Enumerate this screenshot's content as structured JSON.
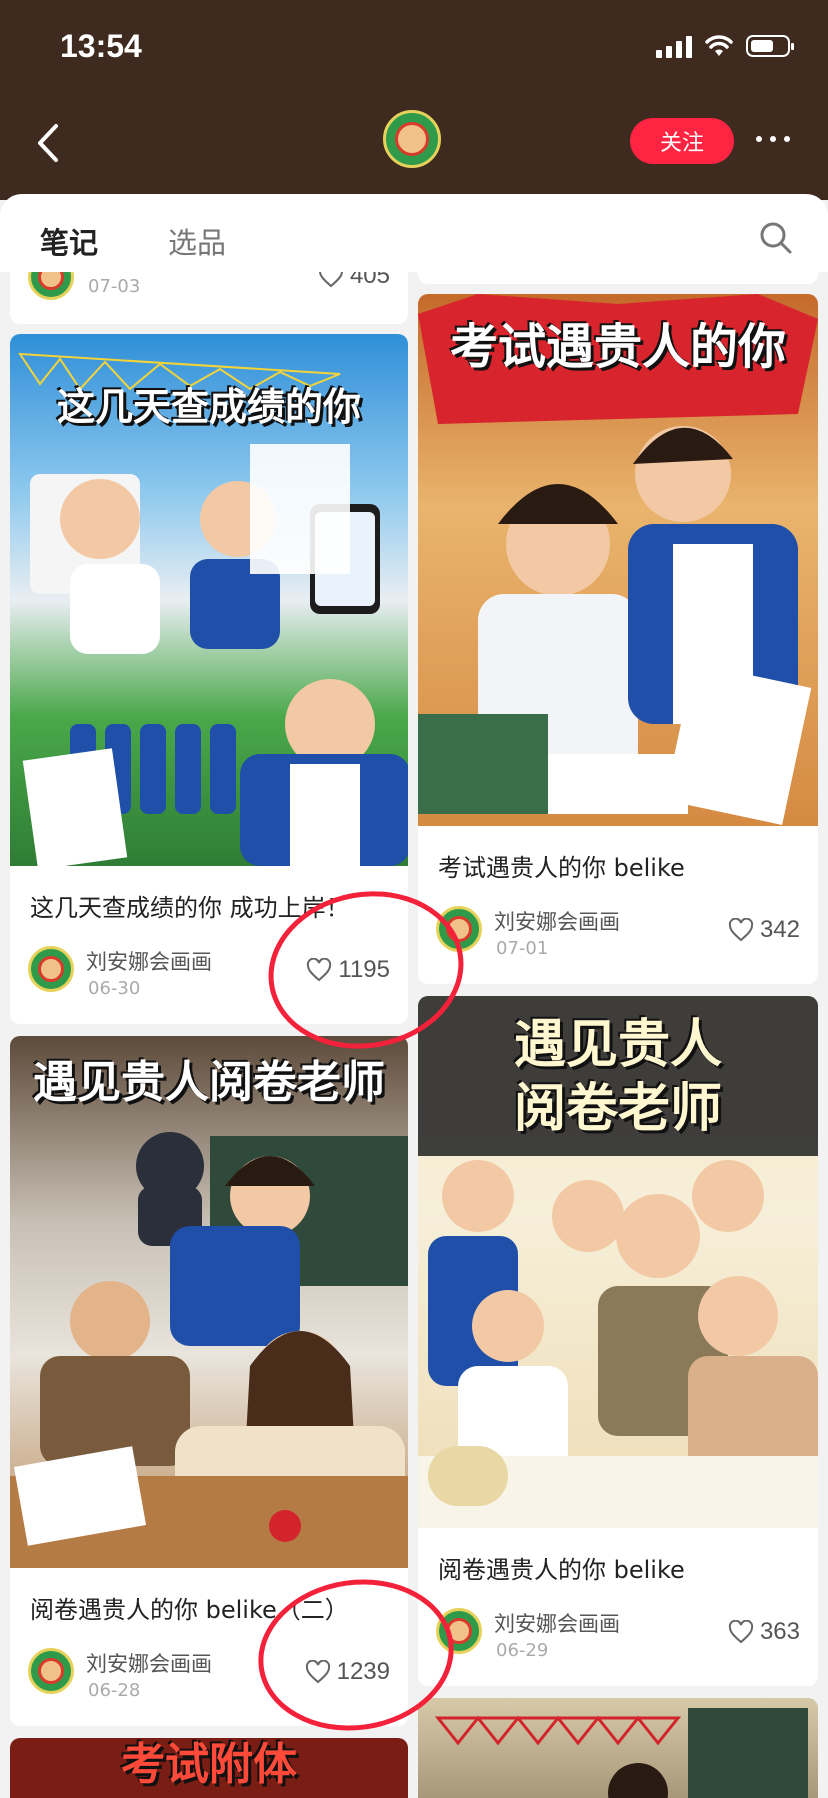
{
  "status": {
    "time": "13:54"
  },
  "header": {
    "follow_label": "关注"
  },
  "tabs": {
    "notes": "笔记",
    "products": "选品"
  },
  "top_card": {
    "date": "07-03",
    "likes": "405"
  },
  "cards": [
    {
      "image_text": "这几天查成绩的你",
      "title": "这几天查成绩的你 成功上岸！",
      "author": "刘安娜会画画",
      "date": "06-30",
      "likes": "1195"
    },
    {
      "image_text": "考试遇贵人的你",
      "title": "考试遇贵人的你 belike",
      "author": "刘安娜会画画",
      "date": "07-01",
      "likes": "342"
    },
    {
      "image_text": "遇见贵人阅卷老师",
      "title": "阅卷遇贵人的你 belike（二）",
      "author": "刘安娜会画画",
      "date": "06-28",
      "likes": "1239"
    },
    {
      "image_text_1": "遇见贵人",
      "image_text_2": "阅卷老师",
      "title": "阅卷遇贵人的你 belike",
      "author": "刘安娜会画画",
      "date": "06-29",
      "likes": "363"
    }
  ],
  "bottom_card": {
    "image_text": "考试附体"
  },
  "colors": {
    "header_bg": "#3e2a1f",
    "accent": "#ff2442",
    "annotation": "#f4213a"
  }
}
